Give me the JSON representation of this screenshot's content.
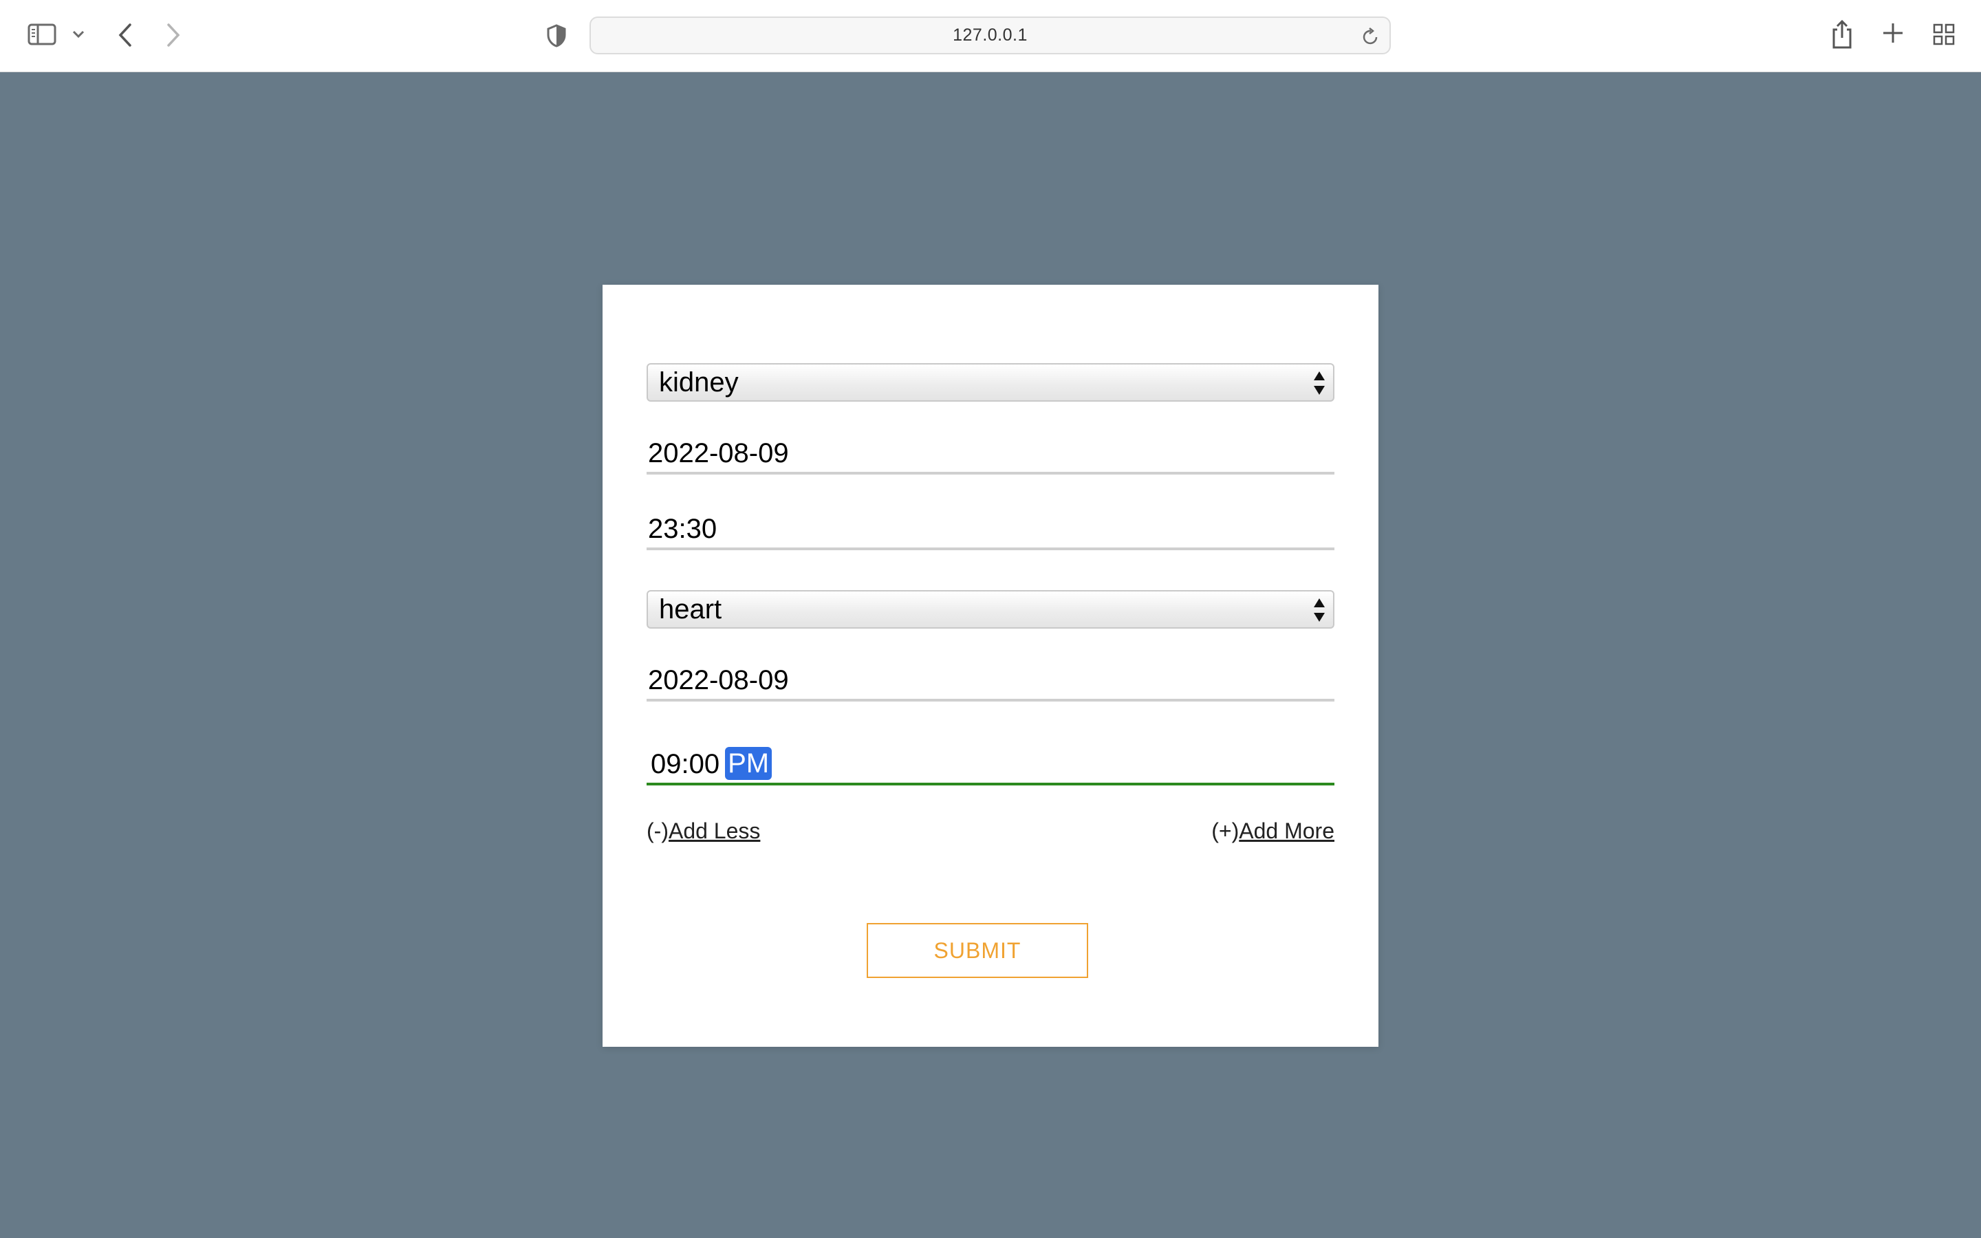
{
  "browser": {
    "url": "127.0.0.1",
    "icons": {
      "sidebar": "sidebar-icon",
      "sidebar_menu": "chevron-down-icon",
      "back": "back-icon",
      "forward": "forward-icon",
      "privacy": "shield-icon",
      "reload": "reload-icon",
      "share": "share-icon",
      "new_tab": "plus-icon",
      "tab_overview": "grid-icon"
    }
  },
  "form": {
    "organ_1": {
      "value": "kidney"
    },
    "date_1": {
      "value": "2022-08-09"
    },
    "time_1": {
      "value": "23:30"
    },
    "organ_2": {
      "value": "heart"
    },
    "date_2": {
      "value": "2022-08-09"
    },
    "time_2": {
      "value": "09:00",
      "ampm": "PM",
      "ampm_selected": true
    },
    "add_less_prefix": "(-)",
    "add_less_label": "Add Less",
    "add_more_prefix": "(+)",
    "add_more_label": "Add More",
    "submit_label": "SUBMIT"
  },
  "colors": {
    "page_background": "#677a88",
    "submit_accent": "#f0a231",
    "focus_underline": "#2c8a1e",
    "selection": "#2f6fe4"
  }
}
